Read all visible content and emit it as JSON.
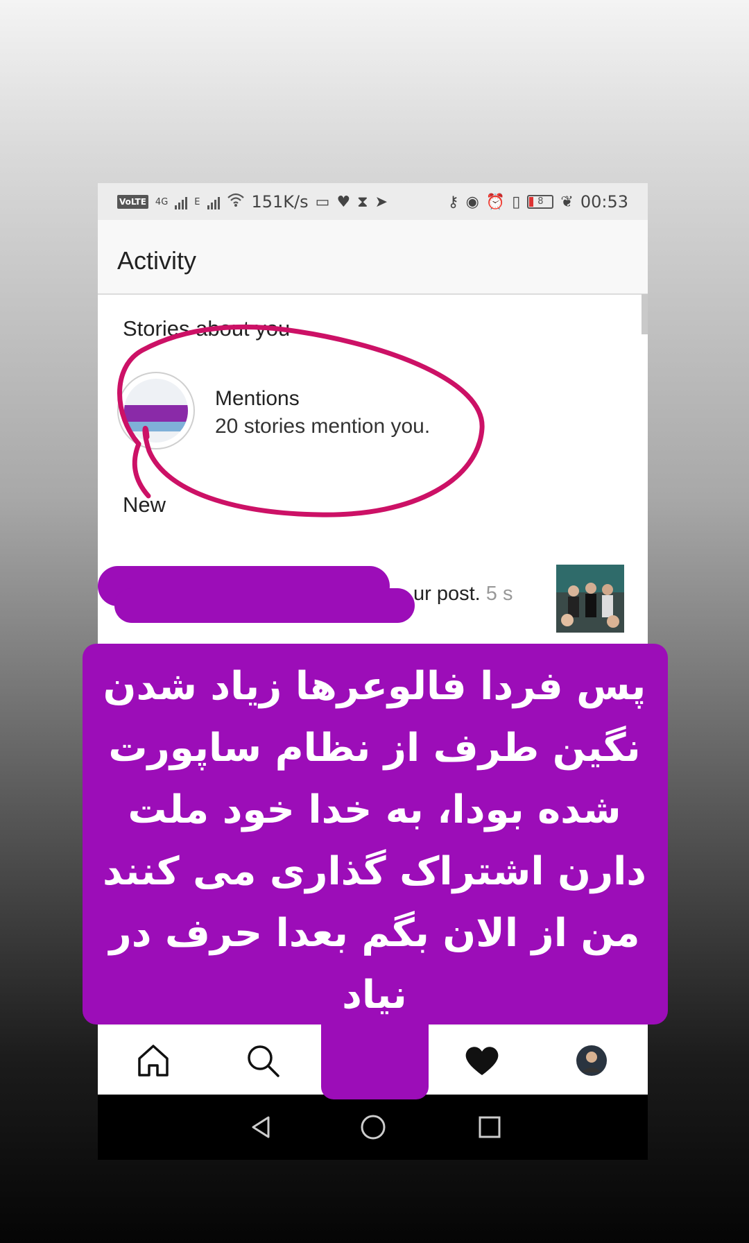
{
  "status_bar": {
    "volte": "VoLTE",
    "network_1": "4G",
    "network_2": "E",
    "speed": "151K/s",
    "battery_level": "8",
    "time": "00:53"
  },
  "app_bar": {
    "title": "Activity"
  },
  "stories_section": {
    "heading": "Stories about you",
    "mention": {
      "title": "Mentions",
      "subtitle": "20 stories mention you."
    }
  },
  "new_section": {
    "heading": "New",
    "notification": {
      "visible_text": "ur post.",
      "time": "5 s"
    }
  },
  "overlay": {
    "text": "پس فردا فالوعرها زیاد شدن نگین طرف از نظام ساپورت شده بودا، به خدا خود ملت دارن اشتراک گذاری می کنند من از الان بگم بعدا حرف در نیاد",
    "color": "#9c0db8"
  },
  "annotation": {
    "ellipse_color": "#cc1166"
  },
  "tab_bar": {
    "items": [
      "home-icon",
      "search-icon",
      "add-icon",
      "heart-icon",
      "profile-avatar"
    ]
  },
  "nav_bar": {
    "items": [
      "back-icon",
      "home-circle-icon",
      "recents-square-icon"
    ]
  }
}
